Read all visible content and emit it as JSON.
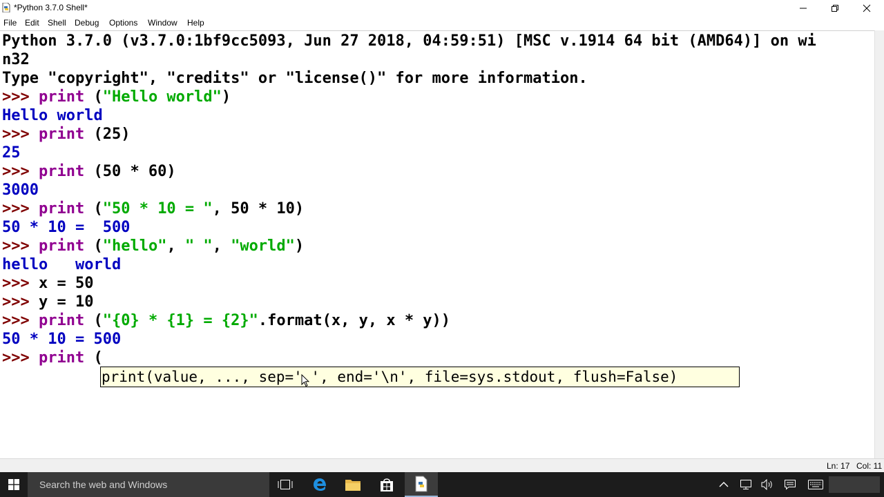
{
  "window": {
    "title": "*Python 3.7.0 Shell*"
  },
  "menu": [
    "File",
    "Edit",
    "Shell",
    "Debug",
    "Options",
    "Window",
    "Help"
  ],
  "shell": {
    "banner1": "Python 3.7.0 (v3.7.0:1bf9cc5093, Jun 27 2018, 04:59:51) [MSC v.1914 64 bit (AMD64)] on wi",
    "banner2": "n32",
    "banner3": "Type \"copyright\", \"credits\" or \"license()\" for more information.",
    "prompt": ">>> ",
    "lines": [
      {
        "kw": "print",
        "rest1": " (",
        "str": "\"Hello world\"",
        "rest2": ")"
      },
      {
        "out": "Hello world"
      },
      {
        "kw": "print",
        "rest1": " (25)"
      },
      {
        "out": "25"
      },
      {
        "kw": "print",
        "rest1": " (50 * 60)"
      },
      {
        "out": "3000"
      },
      {
        "kw": "print",
        "rest1": " (",
        "str": "\"50 * 10 = \"",
        "rest2": ", 50 * 10)"
      },
      {
        "out": "50 * 10 =  500"
      },
      {
        "kw": "print",
        "rest1": " (",
        "str": "\"hello\"",
        "rest2": ", ",
        "str2": "\" \"",
        "rest3": ", ",
        "str3": "\"world\"",
        "rest4": ")"
      },
      {
        "out": "hello   world"
      },
      {
        "rest1": "x = 50"
      },
      {
        "rest1": "y = 10"
      },
      {
        "kw": "print",
        "rest1": " (",
        "str": "\"{0} * {1} = {2}\"",
        "rest2": ".format(x, y, x * y))"
      },
      {
        "out": "50 * 10 = 500"
      },
      {
        "kw": "print",
        "rest1": " ("
      }
    ],
    "calltip": "print(value, ..., sep=' ', end='\\n', file=sys.stdout, flush=False)"
  },
  "status": {
    "line": "Ln: 17",
    "col": "Col: 11"
  },
  "taskbar": {
    "search_placeholder": "Search the web and Windows",
    "icons": [
      "windows-start-icon",
      "task-view-icon",
      "edge-icon",
      "file-explorer-icon",
      "store-icon",
      "python-idle-icon"
    ],
    "tray": [
      "chevron-up-icon",
      "network-icon",
      "volume-icon",
      "notification-icon",
      "keyboard-icon"
    ]
  },
  "colors": {
    "prompt": "#7f0000",
    "keyword": "#900090",
    "string": "#00aa00",
    "output": "#0000c0",
    "calltip_bg": "#ffffe0"
  }
}
